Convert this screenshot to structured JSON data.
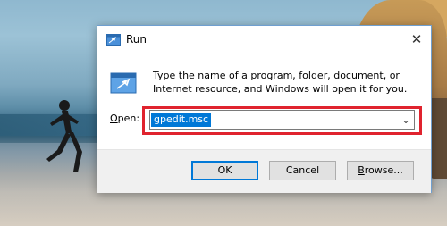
{
  "dialog": {
    "title": "Run",
    "description": "Type the name of a program, folder, document, or Internet resource, and Windows will open it for you.",
    "open_label_mnemonic": "O",
    "open_label_rest": "pen:",
    "input_value": "gpedit.msc",
    "buttons": {
      "ok": "OK",
      "cancel": "Cancel",
      "browse_mnemonic": "B",
      "browse_rest": "rowse..."
    }
  },
  "icons": {
    "title": "run-icon",
    "main": "run-program-icon",
    "close": "close-icon",
    "dropdown": "chevron-down-icon"
  },
  "colors": {
    "highlight": "#e0232e",
    "accent": "#0078d7"
  }
}
